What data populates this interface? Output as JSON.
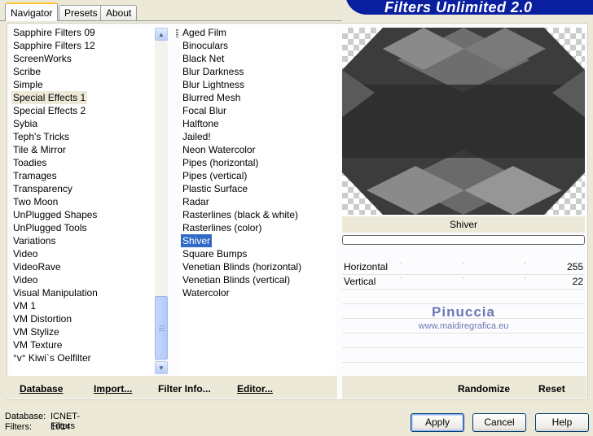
{
  "banner": {
    "title": "Filters Unlimited 2.0"
  },
  "tabs": [
    {
      "label": "Navigator",
      "active": true
    },
    {
      "label": "Presets",
      "active": false
    },
    {
      "label": "About",
      "active": false
    }
  ],
  "categories": {
    "items": [
      "Sapphire Filters 09",
      "Sapphire Filters 12",
      "ScreenWorks",
      "Scribe",
      "Simple",
      "Special Effects 1",
      "Special Effects 2",
      "Sybia",
      "Teph's Tricks",
      "Tile & Mirror",
      "Toadies",
      "Tramages",
      "Transparency",
      "Two Moon",
      "UnPlugged Shapes",
      "UnPlugged Tools",
      "Variations",
      "Video",
      "VideoRave",
      "Video",
      "Visual Manipulation",
      "VM 1",
      "VM Distortion",
      "VM Stylize",
      "VM Texture",
      "°v° Kiwi`s Oelfilter"
    ],
    "highlighted_index": 5
  },
  "filters": {
    "items": [
      "Aged Film",
      "Binoculars",
      "Black Net",
      "Blur Darkness",
      "Blur Lightness",
      "Blurred Mesh",
      "Focal Blur",
      "Halftone",
      "Jailed!",
      "Neon Watercolor",
      "Pipes (horizontal)",
      "Pipes (vertical)",
      "Plastic Surface",
      "Radar",
      "Rasterlines (black & white)",
      "Rasterlines (color)",
      "Shiver",
      "Square Bumps",
      "Venetian Blinds (horizontal)",
      "Venetian Blinds (vertical)",
      "Watercolor"
    ],
    "selected_index": 16
  },
  "preview": {
    "filter_name": "Shiver",
    "progress": 0
  },
  "params": [
    {
      "label": "Horizontal",
      "value": "255"
    },
    {
      "label": "Vertical",
      "value": "22"
    }
  ],
  "watermark": {
    "line1": "Pinuccia",
    "line2": "www.maidiregrafica.eu"
  },
  "toolbar": {
    "database": "Database",
    "import": "Import...",
    "filter_info": "Filter Info...",
    "editor": "Editor...",
    "randomize": "Randomize",
    "reset": "Reset"
  },
  "status": {
    "database_label": "Database:",
    "database_value": "ICNET-Filters",
    "filters_label": "Filters:",
    "filters_value": "1014"
  },
  "buttons": {
    "apply": "Apply",
    "cancel": "Cancel",
    "help": "Help"
  },
  "colors": {
    "banner": "#0a1fa0",
    "selection": "#316ac5",
    "window": "#ece9d8"
  }
}
